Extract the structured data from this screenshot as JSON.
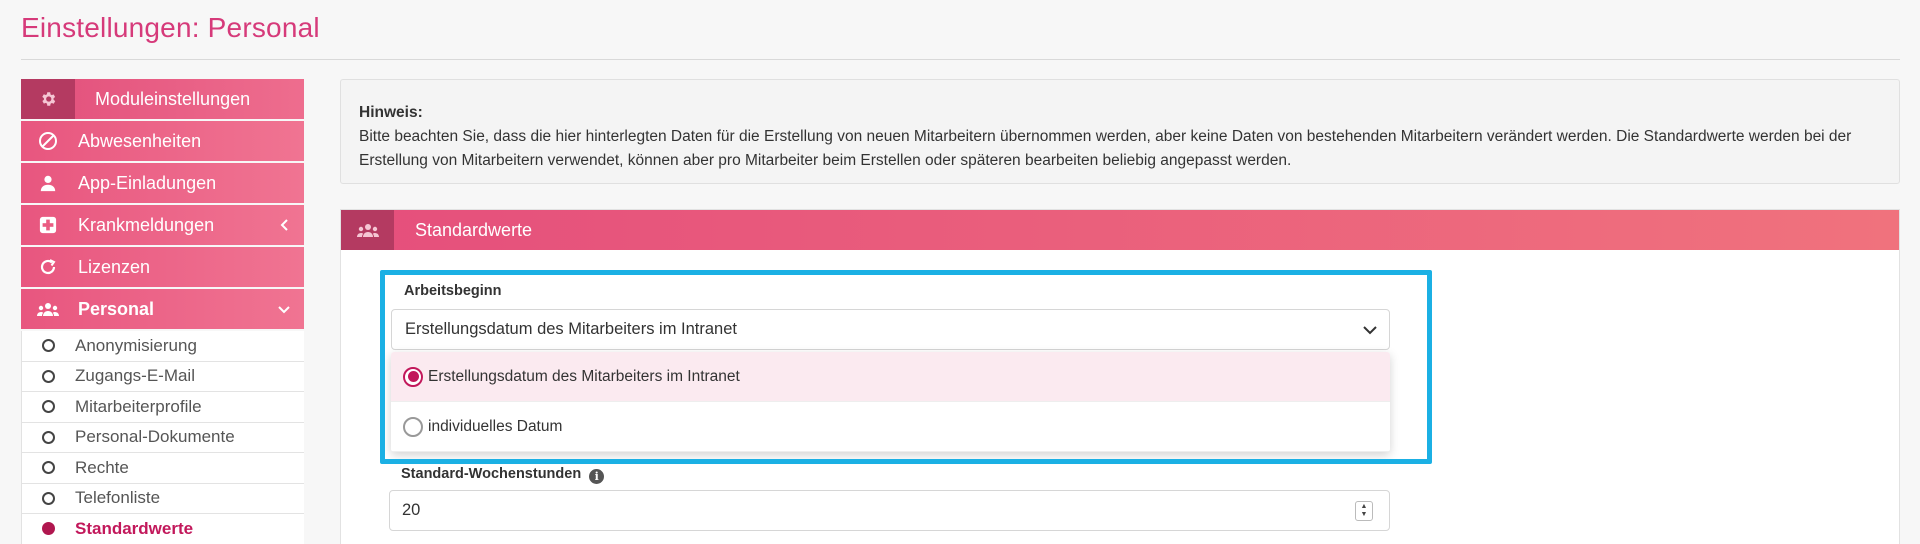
{
  "page": {
    "title": "Einstellungen: Personal"
  },
  "sidebar": {
    "header": {
      "label": "Moduleinstellungen",
      "icon": "gear-icon"
    },
    "items": [
      {
        "label": "Abwesenheiten",
        "icon": "ban-icon"
      },
      {
        "label": "App-Einladungen",
        "icon": "user-icon"
      },
      {
        "label": "Krankmeldungen",
        "icon": "medical-icon",
        "chevron": "chevron-left-icon"
      },
      {
        "label": "Lizenzen",
        "icon": "refresh-icon"
      },
      {
        "label": "Personal",
        "icon": "users-icon",
        "chevron": "chevron-down-icon"
      }
    ],
    "subitems": [
      "Anonymisierung",
      "Zugangs-E-Mail",
      "Mitarbeiterprofile",
      "Personal-Dokumente",
      "Rechte",
      "Telefonliste",
      "Standardwerte"
    ],
    "active_subitem": "Standardwerte"
  },
  "note": {
    "title": "Hinweis:",
    "text": "Bitte beachten Sie, dass die hier hinterlegten Daten für die Erstellung von neuen Mitarbeitern übernommen werden, aber keine Daten von bestehenden Mitarbeitern verändert werden. Die Standardwerte werden bei der Erstellung von Mitarbeitern verwendet, können aber pro Mitarbeiter beim Erstellen oder späteren bearbeiten beliebig angepasst werden."
  },
  "panel": {
    "title": "Standardwerte",
    "icon": "users-icon"
  },
  "form": {
    "arbeitsbeginn": {
      "label": "Arbeitsbeginn",
      "value": "Erstellungsdatum des Mitarbeiters im Intranet",
      "options": [
        {
          "label": "Erstellungsdatum des Mitarbeiters im Intranet",
          "selected": true
        },
        {
          "label": "individuelles Datum",
          "selected": false
        }
      ]
    },
    "wochenstunden": {
      "label": "Standard-Wochenstunden",
      "value": "20"
    }
  },
  "colors": {
    "accent": "#e8567f",
    "accent_dark": "#b43a61",
    "title": "#d63a7a",
    "highlight": "#1bb0e4"
  }
}
